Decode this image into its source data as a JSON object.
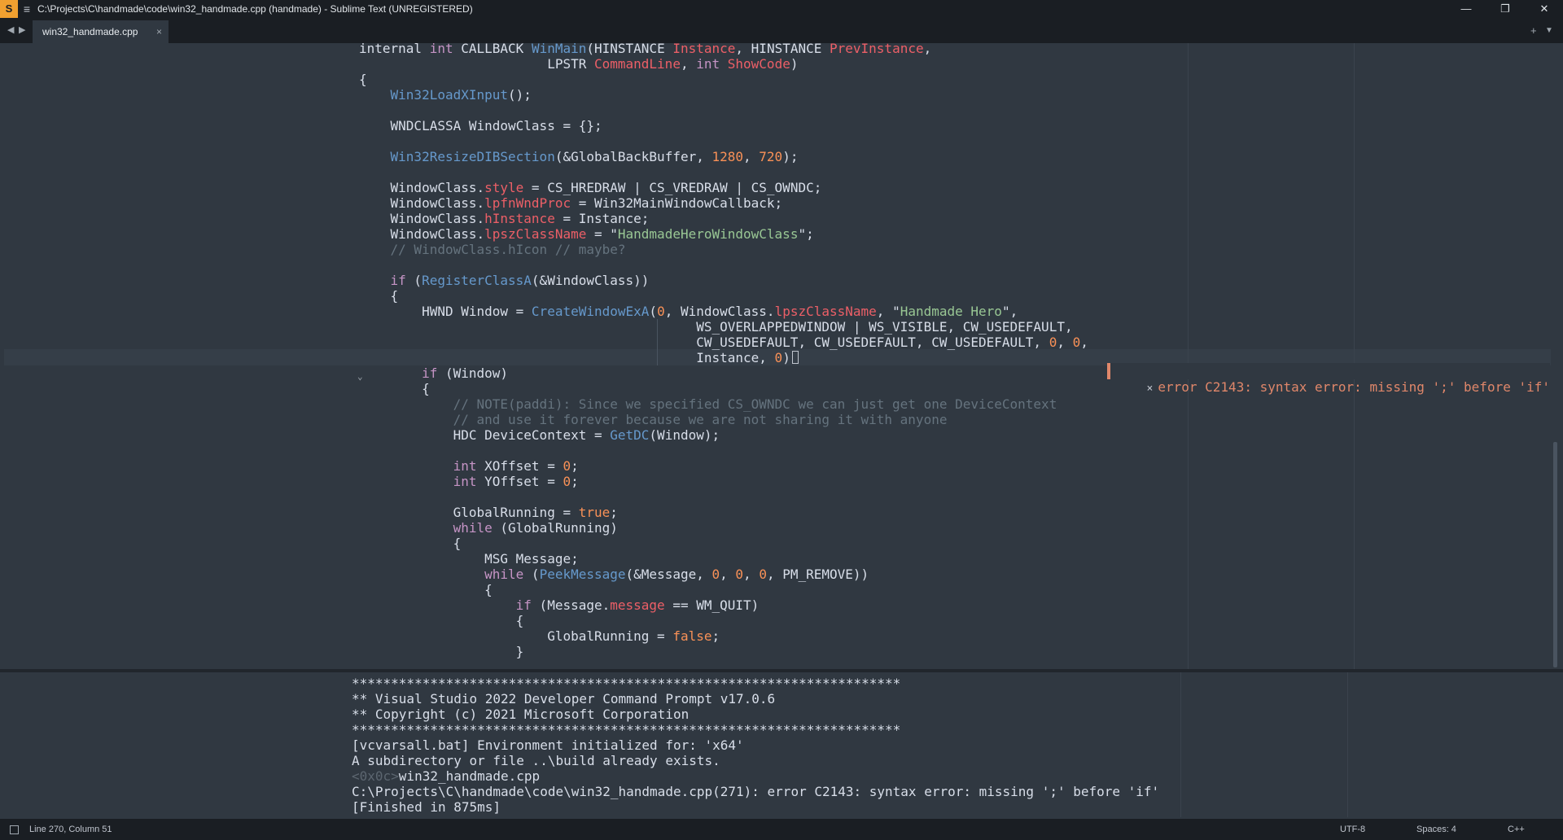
{
  "window": {
    "title": "C:\\Projects\\C\\handmade\\code\\win32_handmade.cpp (handmade) - Sublime Text (UNREGISTERED)",
    "logo": "S",
    "controls": {
      "minimize": "—",
      "restore": "❐",
      "close": "✕"
    }
  },
  "tabs": [
    {
      "label": "win32_handmade.cpp",
      "close": "×"
    }
  ],
  "tabbar": {
    "back": "◀",
    "forward": "▶",
    "new_tab": "+",
    "tab_list": "▼"
  },
  "editor": {
    "lines": [
      [
        [
          "internal ",
          "t"
        ],
        [
          "int",
          "k"
        ],
        [
          " CALLBACK ",
          "t"
        ],
        [
          "WinMain",
          "f"
        ],
        [
          "(HINSTANCE ",
          "t"
        ],
        [
          "Instance",
          "m"
        ],
        [
          ", HINSTANCE ",
          "t"
        ],
        [
          "PrevInstance",
          "m"
        ],
        [
          ",",
          "t"
        ]
      ],
      [
        [
          "                        LPSTR ",
          "t"
        ],
        [
          "CommandLine",
          "m"
        ],
        [
          ", ",
          "t"
        ],
        [
          "int",
          "k"
        ],
        [
          " ",
          "t"
        ],
        [
          "ShowCode",
          "m"
        ],
        [
          ")",
          "t"
        ]
      ],
      [
        [
          "{",
          "t"
        ]
      ],
      [
        [
          "    ",
          "t"
        ],
        [
          "Win32LoadXInput",
          "f"
        ],
        [
          "();",
          "t"
        ]
      ],
      [
        [
          "",
          "t"
        ]
      ],
      [
        [
          "    WNDCLASSA WindowClass = {};",
          "t"
        ]
      ],
      [
        [
          "",
          "t"
        ]
      ],
      [
        [
          "    ",
          "t"
        ],
        [
          "Win32ResizeDIBSection",
          "f"
        ],
        [
          "(&GlobalBackBuffer, ",
          "t"
        ],
        [
          "1280",
          "p"
        ],
        [
          ", ",
          "t"
        ],
        [
          "720",
          "p"
        ],
        [
          ");",
          "t"
        ]
      ],
      [
        [
          "",
          "t"
        ]
      ],
      [
        [
          "    WindowClass.",
          "t"
        ],
        [
          "style",
          "m"
        ],
        [
          " = CS_HREDRAW | CS_VREDRAW | CS_OWNDC;",
          "t"
        ]
      ],
      [
        [
          "    WindowClass.",
          "t"
        ],
        [
          "lpfnWndProc",
          "m"
        ],
        [
          " = Win32MainWindowCallback;",
          "t"
        ]
      ],
      [
        [
          "    WindowClass.",
          "t"
        ],
        [
          "hInstance",
          "m"
        ],
        [
          " = Instance;",
          "t"
        ]
      ],
      [
        [
          "    WindowClass.",
          "t"
        ],
        [
          "lpszClassName",
          "m"
        ],
        [
          " = \"",
          "t"
        ],
        [
          "HandmadeHeroWindowClass",
          "s"
        ],
        [
          "\";",
          "t"
        ]
      ],
      [
        [
          "    // WindowClass.hIcon // maybe?",
          "c"
        ]
      ],
      [
        [
          "",
          "t"
        ]
      ],
      [
        [
          "    ",
          "t"
        ],
        [
          "if",
          "k"
        ],
        [
          " (",
          "t"
        ],
        [
          "RegisterClassA",
          "f"
        ],
        [
          "(&WindowClass))",
          "t"
        ]
      ],
      [
        [
          "    {",
          "t"
        ]
      ],
      [
        [
          "        HWND Window = ",
          "t"
        ],
        [
          "CreateWindowExA",
          "f"
        ],
        [
          "(",
          "t"
        ],
        [
          "0",
          "p"
        ],
        [
          ", WindowClass.",
          "t"
        ],
        [
          "lpszClassName",
          "m"
        ],
        [
          ", \"",
          "t"
        ],
        [
          "Handmade Hero",
          "s"
        ],
        [
          "\",",
          "t"
        ]
      ],
      [
        [
          "                                           WS_OVERLAPPEDWINDOW | WS_VISIBLE, CW_USEDEFAULT,",
          "t"
        ]
      ],
      [
        [
          "                                           CW_USEDEFAULT, CW_USEDEFAULT, CW_USEDEFAULT, ",
          "t"
        ],
        [
          "0",
          "p"
        ],
        [
          ", ",
          "t"
        ],
        [
          "0",
          "p"
        ],
        [
          ",",
          "t"
        ]
      ],
      [
        [
          "                                           Instance, ",
          "t"
        ],
        [
          "0",
          "p"
        ],
        [
          ")",
          "t"
        ]
      ],
      [
        [
          "        ",
          "t"
        ],
        [
          "if",
          "k"
        ],
        [
          " (Window)",
          "t"
        ]
      ],
      [
        [
          "        {",
          "t"
        ]
      ],
      [
        [
          "            // NOTE(paddi): Since we specified CS_OWNDC we can just get one DeviceContext",
          "c"
        ]
      ],
      [
        [
          "            // and use it forever because we are not sharing it with anyone",
          "c"
        ]
      ],
      [
        [
          "            HDC DeviceContext = ",
          "t"
        ],
        [
          "GetDC",
          "f"
        ],
        [
          "(Window);",
          "t"
        ]
      ],
      [
        [
          "",
          "t"
        ]
      ],
      [
        [
          "            ",
          "t"
        ],
        [
          "int",
          "k"
        ],
        [
          " XOffset = ",
          "t"
        ],
        [
          "0",
          "p"
        ],
        [
          ";",
          "t"
        ]
      ],
      [
        [
          "            ",
          "t"
        ],
        [
          "int",
          "k"
        ],
        [
          " YOffset = ",
          "t"
        ],
        [
          "0",
          "p"
        ],
        [
          ";",
          "t"
        ]
      ],
      [
        [
          "",
          "t"
        ]
      ],
      [
        [
          "            GlobalRunning = ",
          "t"
        ],
        [
          "true",
          "p"
        ],
        [
          ";",
          "t"
        ]
      ],
      [
        [
          "            ",
          "t"
        ],
        [
          "while",
          "k"
        ],
        [
          " (GlobalRunning)",
          "t"
        ]
      ],
      [
        [
          "            {",
          "t"
        ]
      ],
      [
        [
          "                MSG Message;",
          "t"
        ]
      ],
      [
        [
          "                ",
          "t"
        ],
        [
          "while",
          "k"
        ],
        [
          " (",
          "t"
        ],
        [
          "PeekMessage",
          "f"
        ],
        [
          "(&Message, ",
          "t"
        ],
        [
          "0",
          "p"
        ],
        [
          ", ",
          "t"
        ],
        [
          "0",
          "p"
        ],
        [
          ", ",
          "t"
        ],
        [
          "0",
          "p"
        ],
        [
          ", PM_REMOVE))",
          "t"
        ]
      ],
      [
        [
          "                {",
          "t"
        ]
      ],
      [
        [
          "                    ",
          "t"
        ],
        [
          "if",
          "k"
        ],
        [
          " (Message.",
          "t"
        ],
        [
          "message",
          "m"
        ],
        [
          " == WM_QUIT)",
          "t"
        ]
      ],
      [
        [
          "                    {",
          "t"
        ]
      ],
      [
        [
          "                        GlobalRunning = ",
          "t"
        ],
        [
          "false",
          "p"
        ],
        [
          ";",
          "t"
        ]
      ],
      [
        [
          "                    }",
          "t"
        ]
      ]
    ],
    "error_popup": {
      "close": "×",
      "message": "error C2143: syntax error: missing ';' before 'if'"
    },
    "fold_marker": "⌄",
    "colors": {
      "background": "#303841",
      "keyword": "#c594c5",
      "function": "#6699cc",
      "member": "#ec5f67",
      "number": "#f99157",
      "string": "#99c794",
      "comment": "#65737e",
      "error": "#e0876a"
    }
  },
  "output_panel": {
    "lines": [
      [
        [
          "**********************************************************************",
          "t"
        ]
      ],
      [
        [
          "** Visual Studio 2022 Developer Command Prompt v17.0.6",
          "t"
        ]
      ],
      [
        [
          "** Copyright (c) 2021 Microsoft Corporation",
          "t"
        ]
      ],
      [
        [
          "**********************************************************************",
          "t"
        ]
      ],
      [
        [
          "[vcvarsall.bat] Environment initialized for: 'x64'",
          "t"
        ]
      ],
      [
        [
          "A subdirectory or file ..\\build already exists.",
          "t"
        ]
      ],
      [
        [
          "<0x0c>",
          "dim"
        ],
        [
          "win32_handmade.cpp",
          "t"
        ]
      ],
      [
        [
          "C:\\Projects\\C\\handmade\\code\\win32_handmade.cpp(271): error C2143: syntax error: missing ';' before 'if'",
          "t"
        ]
      ],
      [
        [
          "[Finished in 875ms]",
          "t"
        ]
      ]
    ]
  },
  "status": {
    "position": "Line 270, Column 51",
    "encoding": "UTF-8",
    "indentation": "Spaces: 4",
    "syntax": "C++"
  }
}
